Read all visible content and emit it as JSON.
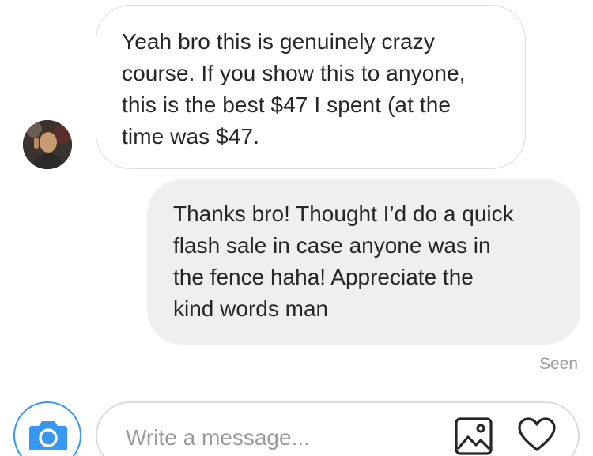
{
  "messages": [
    {
      "direction": "incoming",
      "lines": [
        "Yeah bro this is genuinely crazy",
        "course. If you show this to anyone,",
        "this is the best $47 I spent (at the",
        "time was $47."
      ]
    },
    {
      "direction": "outgoing",
      "lines": [
        "Thanks bro! Thought I’d do a quick",
        "flash sale in case anyone was in",
        "the fence haha! Appreciate the",
        "kind words man"
      ]
    }
  ],
  "status": {
    "seen": "Seen"
  },
  "composer": {
    "placeholder": "Write a message...",
    "icons": {
      "camera": "camera-icon",
      "photo": "photo-icon",
      "like": "heart-icon"
    }
  },
  "colors": {
    "accent": "#3897f0",
    "outgoing_bubble": "#efefef",
    "incoming_border": "#dbdbdb",
    "muted_text": "#999999"
  }
}
